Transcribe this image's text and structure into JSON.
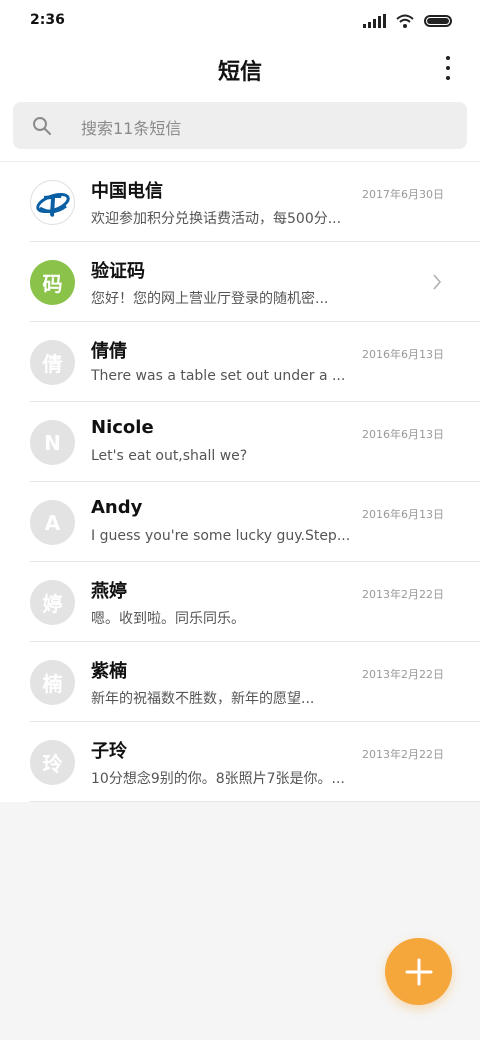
{
  "status_bar": {
    "time": "2:36"
  },
  "header": {
    "title": "短信"
  },
  "search": {
    "placeholder": "搜索11条短信"
  },
  "messages": [
    {
      "sender": "中国电信",
      "date": "2017年6月30日",
      "preview": "欢迎参加积分兑换话费活动，每500分...",
      "avatar_text": "",
      "avatar_icon": "china-telecom-logo"
    },
    {
      "sender": "验证码",
      "date": "",
      "preview": "您好！您的网上营业厅登录的随机密...",
      "avatar_text": "码",
      "avatar_color": "#8bc34a"
    },
    {
      "sender": "倩倩",
      "date": "2016年6月13日",
      "preview": "There was a table set out under a ...",
      "avatar_text": "倩"
    },
    {
      "sender": "Nicole",
      "date": "2016年6月13日",
      "preview": "Let's eat out,shall we?",
      "avatar_text": "N"
    },
    {
      "sender": "Andy",
      "date": "2016年6月13日",
      "preview": "I guess you're some lucky guy.Step...",
      "avatar_text": "A"
    },
    {
      "sender": "燕婷",
      "date": "2013年2月22日",
      "preview": "嗯。收到啦。同乐同乐。",
      "avatar_text": "婷"
    },
    {
      "sender": "紫楠",
      "date": "2013年2月22日",
      "preview": "新年的祝福数不胜数，新年的愿望...",
      "avatar_text": "楠"
    },
    {
      "sender": "子玲",
      "date": "2013年2月22日",
      "preview": "10分想念9别的你。8张照片7张是你。...",
      "avatar_text": "玲"
    }
  ],
  "colors": {
    "accent": "#f5a73b",
    "avatar_gray": "#e3e3e3",
    "avatar_green": "#8bc34a",
    "telecom_blue": "#0b5fa5"
  }
}
